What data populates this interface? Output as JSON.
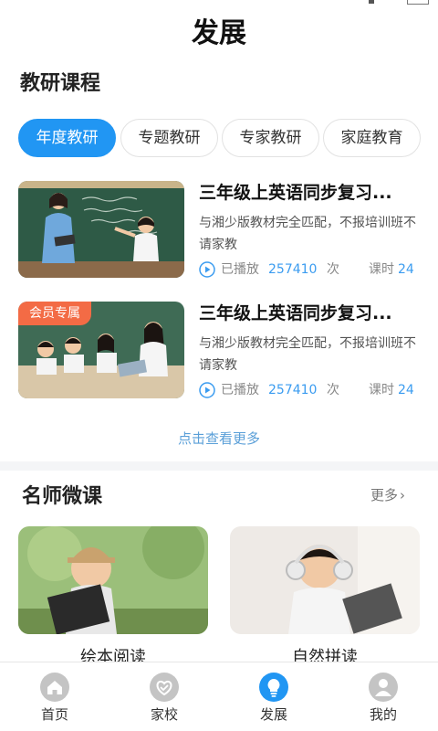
{
  "header": {
    "title": "发展"
  },
  "research": {
    "section_title": "教研课程",
    "tabs": [
      "年度教研",
      "专题教研",
      "专家教研",
      "家庭教育"
    ],
    "courses": [
      {
        "title": "三年级上英语同步复习...",
        "desc": "与湘少版教材完全匹配，不报培训班不请家教",
        "played_label": "已播放",
        "played_count": "257410",
        "played_unit": "次",
        "lesson_label": "课时",
        "lesson_count": "24",
        "badge": ""
      },
      {
        "title": "三年级上英语同步复习...",
        "desc": "与湘少版教材完全匹配，不报培训班不请家教",
        "played_label": "已播放",
        "played_count": "257410",
        "played_unit": "次",
        "lesson_label": "课时",
        "lesson_count": "24",
        "badge": "会员专属"
      }
    ],
    "more_link": "点击查看更多"
  },
  "teachers": {
    "section_title": "名师微课",
    "more": "更多",
    "videos": [
      {
        "label": "绘本阅读"
      },
      {
        "label": "自然拼读"
      }
    ]
  },
  "nav": {
    "items": [
      {
        "label": "首页",
        "icon": "home-icon",
        "active": false
      },
      {
        "label": "家校",
        "icon": "home-school-icon",
        "active": false
      },
      {
        "label": "发展",
        "icon": "lightbulb-icon",
        "active": true
      },
      {
        "label": "我的",
        "icon": "user-icon",
        "active": false
      }
    ],
    "active_color": "#2196f3",
    "inactive_color": "#c4c4c4"
  },
  "colors": {
    "accent": "#2196f3",
    "badge": "#f36b45",
    "link": "#3b9cf0"
  }
}
